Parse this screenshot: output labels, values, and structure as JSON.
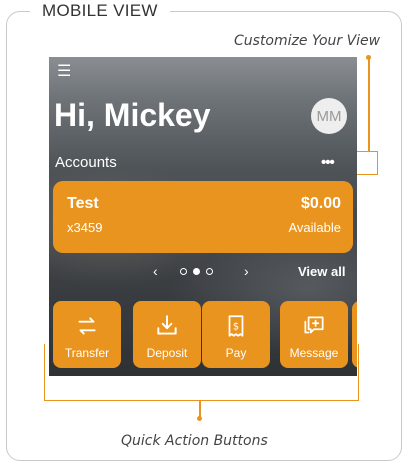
{
  "section_label": "MOBILE VIEW",
  "callouts": {
    "top": "Customize Your View",
    "bottom": "Quick Action Buttons"
  },
  "header": {
    "greeting": "Hi, Mickey",
    "avatar_initials": "MM"
  },
  "accounts": {
    "label": "Accounts",
    "more_icon": "more-horizontal-icon"
  },
  "account_card": {
    "name": "Test",
    "number": "x3459",
    "balance": "$0.00",
    "balance_label": "Available"
  },
  "pager": {
    "prev": "‹",
    "next": "›",
    "view_all": "View all",
    "dot_count": 3,
    "active_index": 1
  },
  "quick_actions": [
    {
      "label": "Transfer",
      "icon": "transfer-icon"
    },
    {
      "label": "Deposit",
      "icon": "deposit-icon"
    },
    {
      "label": "Pay",
      "icon": "pay-icon"
    },
    {
      "label": "Message",
      "icon": "message-icon"
    }
  ],
  "colors": {
    "accent": "#e9941f",
    "bracket": "#e9941f",
    "frame": "#c9c9c9"
  }
}
